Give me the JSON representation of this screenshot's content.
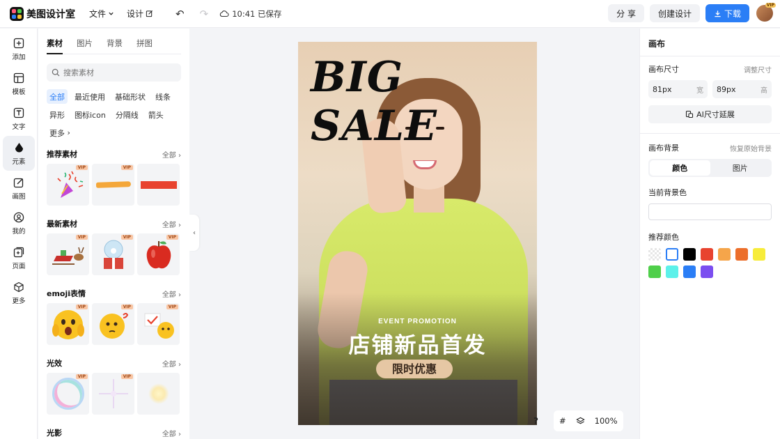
{
  "app": {
    "name": "美图设计室"
  },
  "header": {
    "menu": [
      {
        "label": "文件"
      },
      {
        "label": "设计"
      }
    ],
    "save_status": "10:41 已保存",
    "share_label": "分 享",
    "create_label": "创建设计",
    "download_label": "下载",
    "avatar_badge": "VIP"
  },
  "rail": [
    {
      "label": "添加",
      "icon": "plus-square-icon"
    },
    {
      "label": "模板",
      "icon": "template-icon"
    },
    {
      "label": "文字",
      "icon": "text-icon"
    },
    {
      "label": "元素",
      "icon": "shapes-icon"
    },
    {
      "label": "画图",
      "icon": "draw-icon"
    },
    {
      "label": "我的",
      "icon": "user-icon"
    },
    {
      "label": "页面",
      "icon": "page-icon"
    },
    {
      "label": "更多",
      "icon": "cube-icon"
    }
  ],
  "assets": {
    "tabs": [
      "素材",
      "图片",
      "背景",
      "拼图"
    ],
    "search_placeholder": "搜索素材",
    "chips": [
      "全部",
      "最近使用",
      "基础形状",
      "线条",
      "异形",
      "图标icon",
      "分隔线",
      "箭头",
      "更多"
    ],
    "all_label": "全部",
    "vip_label": "VIP",
    "sections": [
      {
        "title": "推荐素材"
      },
      {
        "title": "最新素材"
      },
      {
        "title": "emoji表情"
      },
      {
        "title": "光效"
      },
      {
        "title": "光影"
      }
    ]
  },
  "artboard": {
    "headline": "BIG SALE",
    "subline": "EVENT PROMOTION",
    "title": "店铺新品首发",
    "pill": "限时优惠"
  },
  "canvas_tools": {
    "help": "?",
    "zoom": "100%"
  },
  "right_panel": {
    "title": "画布",
    "size_label": "画布尺寸",
    "adjust_size": "调整尺寸",
    "width_value": "81px",
    "width_unit": "宽",
    "height_value": "89px",
    "height_unit": "高",
    "ai_extend": "AI尺寸延展",
    "bg_label": "画布背景",
    "restore_bg": "恢复原始背景",
    "seg_color": "颜色",
    "seg_image": "图片",
    "current_bg_label": "当前背景色",
    "recommended_label": "推荐颜色",
    "swatches": [
      "transparent",
      "#ffffff",
      "#000000",
      "#e8432f",
      "#f5a54a",
      "#ec6e2a",
      "#f7ec3a",
      "#4fcf4a",
      "#5cf1ea",
      "#2b7ef6",
      "#7b4ef0"
    ]
  }
}
